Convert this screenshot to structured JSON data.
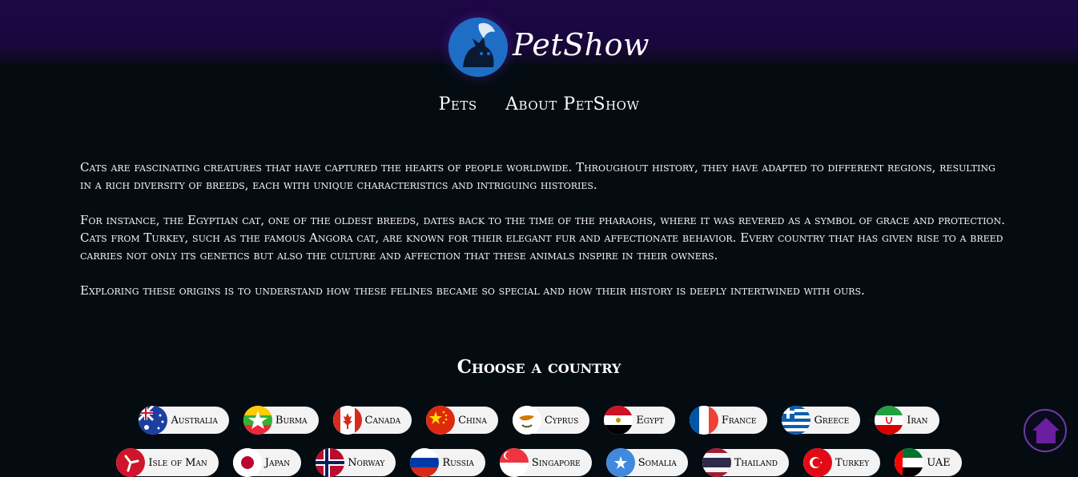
{
  "header": {
    "logo_text": "PetShow",
    "logo_icon": "cat-dog-logo-icon",
    "colors": {
      "header_bg": "#1d0845",
      "logo_blue": "#1e6ec6"
    }
  },
  "nav": {
    "items": [
      "Pets",
      "About PetShow"
    ]
  },
  "intro": {
    "paragraphs": [
      "Cats are fascinating creatures that have captured the hearts of people worldwide. Throughout history, they have adapted to different regions, resulting in a rich diversity of breeds, each with unique characteristics and intriguing histories.",
      "For instance, the Egyptian cat, one of the oldest breeds, dates back to the time of the pharaohs, where it was revered as a symbol of grace and protection. Cats from Turkey, such as the famous Angora cat, are known for their elegant fur and affectionate behavior. Every country that has given rise to a breed carries not only its genetics but also the culture and affection that these animals inspire in their owners.",
      "Exploring these origins is to understand how these felines became so special and how their history is deeply intertwined with ours."
    ]
  },
  "choose_title": "Choose a country",
  "countries": {
    "row1": [
      "Australia",
      "Burma",
      "Canada",
      "China",
      "Cyprus",
      "Egypt",
      "France",
      "Greece",
      "Iran"
    ],
    "row2": [
      "Isle of Man",
      "Japan",
      "Norway",
      "Russia",
      "Singapore",
      "Somalia",
      "Thailand",
      "Turkey",
      "UAE"
    ]
  },
  "home_button": {
    "icon": "home-icon",
    "color": "#6a1fa0"
  },
  "colors": {
    "page_bg": "#040c12",
    "pill_bg": "#f3f3f3"
  }
}
